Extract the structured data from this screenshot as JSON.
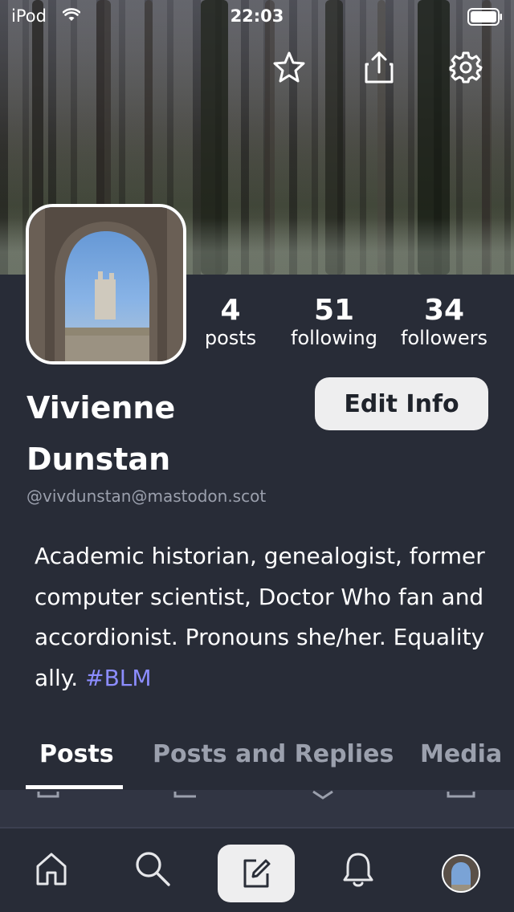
{
  "status_bar": {
    "carrier": "iPod",
    "time": "22:03"
  },
  "header": {
    "icons": [
      "star-icon",
      "share-icon",
      "gear-icon"
    ]
  },
  "profile": {
    "display_name_line1": "Vivienne",
    "display_name_line2": "Dunstan",
    "handle": "@vivdunstan@mastodon.scot",
    "edit_label": "Edit Info",
    "bio_text": "Academic historian, genealogist, former computer scientist, Doctor Who fan and accordionist. Pronouns she/her. Equality ally.",
    "bio_hashtag": "#BLM",
    "stats": [
      {
        "value": "4",
        "label": "posts"
      },
      {
        "value": "51",
        "label": "following"
      },
      {
        "value": "34",
        "label": "followers"
      }
    ]
  },
  "tabs": [
    {
      "label": "Posts",
      "active": true
    },
    {
      "label": "Posts and Replies",
      "active": false
    },
    {
      "label": "Media",
      "active": false
    }
  ],
  "tabbar": {
    "icons": [
      "home-icon",
      "search-icon",
      "compose-icon",
      "bell-icon",
      "profile-avatar"
    ]
  },
  "colors": {
    "background": "#282c37",
    "accent": "#8c8dff",
    "muted_text": "#9ba0ad",
    "button_bg": "#eeeeef"
  }
}
